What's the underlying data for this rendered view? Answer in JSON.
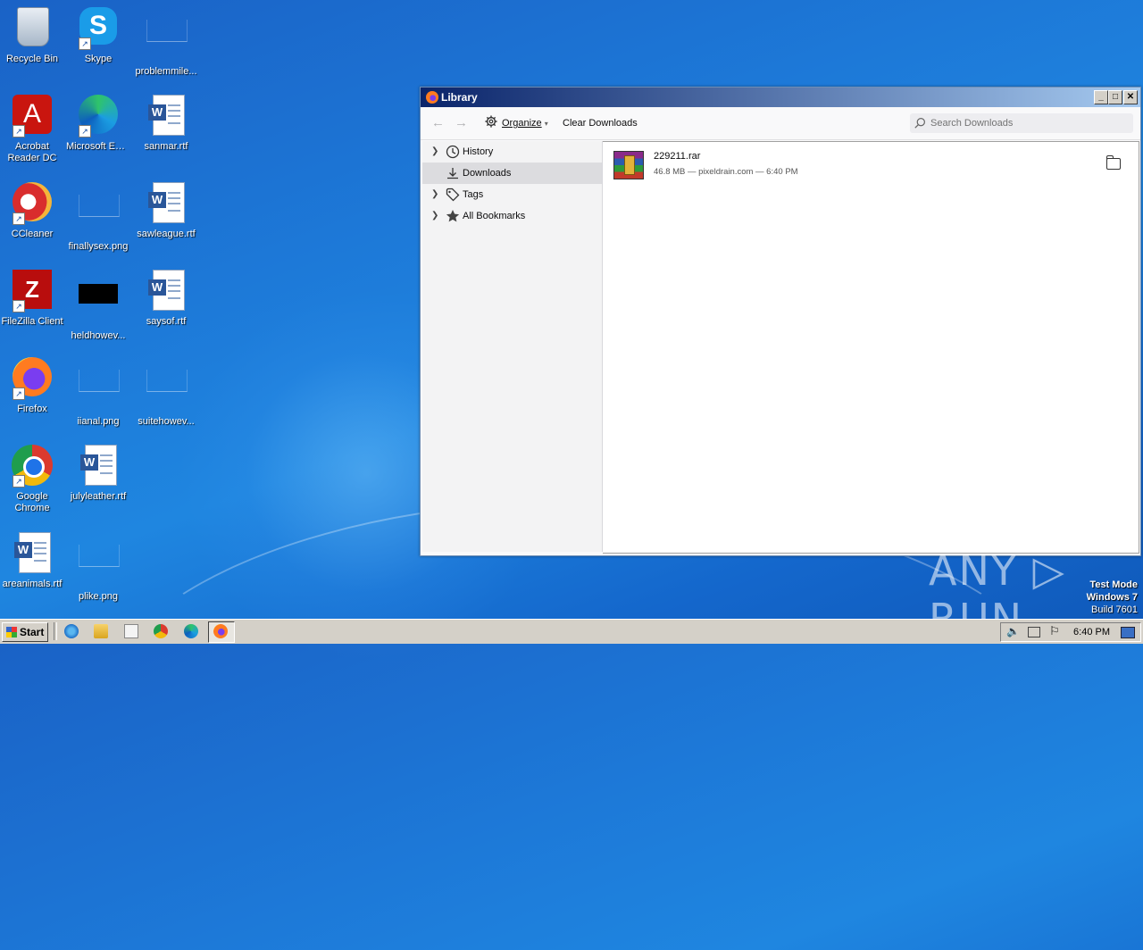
{
  "desktop": {
    "icons": [
      {
        "label": "Recycle Bin",
        "icon": "recycle-bin-icon"
      },
      {
        "label": "Skype",
        "icon": "skype-icon"
      },
      {
        "label": "problemmile...",
        "icon": "image-file-icon"
      },
      {
        "label": "Acrobat Reader DC",
        "icon": "acrobat-icon"
      },
      {
        "label": "Microsoft Edge",
        "icon": "edge-icon"
      },
      {
        "label": "sanmar.rtf",
        "icon": "word-doc-icon"
      },
      {
        "label": "CCleaner",
        "icon": "ccleaner-icon"
      },
      {
        "label": "finallysex.png",
        "icon": "image-file-icon"
      },
      {
        "label": "sawleague.rtf",
        "icon": "word-doc-icon"
      },
      {
        "label": "FileZilla Client",
        "icon": "filezilla-icon"
      },
      {
        "label": "heldhowev...",
        "icon": "image-file-icon"
      },
      {
        "label": "saysof.rtf",
        "icon": "word-doc-icon"
      },
      {
        "label": "Firefox",
        "icon": "firefox-icon"
      },
      {
        "label": "iianal.png",
        "icon": "image-file-icon"
      },
      {
        "label": "suitehowev...",
        "icon": "image-file-icon"
      },
      {
        "label": "Google Chrome",
        "icon": "chrome-icon"
      },
      {
        "label": "julyleather.rtf",
        "icon": "word-doc-icon"
      },
      {
        "label": "areanimals.rtf",
        "icon": "word-doc-icon"
      },
      {
        "label": "plike.png",
        "icon": "image-file-icon"
      }
    ]
  },
  "window": {
    "title": "Library",
    "controls": {
      "minimize": "_",
      "maximize": "□",
      "close": "✕"
    },
    "toolbar": {
      "back": "←",
      "forward": "→",
      "organize": "Organize",
      "organize_caret": "▾",
      "clear_downloads": "Clear Downloads",
      "search_placeholder": "Search Downloads"
    },
    "sidebar": [
      {
        "label": "History",
        "expandable": true,
        "icon": "clock-icon"
      },
      {
        "label": "Downloads",
        "expandable": false,
        "icon": "download-icon",
        "selected": true
      },
      {
        "label": "Tags",
        "expandable": true,
        "icon": "tag-icon"
      },
      {
        "label": "All Bookmarks",
        "expandable": true,
        "icon": "star-icon"
      }
    ],
    "downloads": [
      {
        "name": "229211.rar",
        "meta": "46.8 MB — pixeldrain.com — 6:40 PM"
      }
    ]
  },
  "watermark": "ANY ▷ RUN",
  "testmode": {
    "line1": "Test Mode",
    "line2": "Windows 7",
    "line3": "Build 7601"
  },
  "taskbar": {
    "start": "Start",
    "clock": "6:40 PM"
  },
  "colors": {
    "titlebar_start": "#0a246a",
    "titlebar_end": "#a6caf0",
    "desktop": "#1d79d8"
  }
}
